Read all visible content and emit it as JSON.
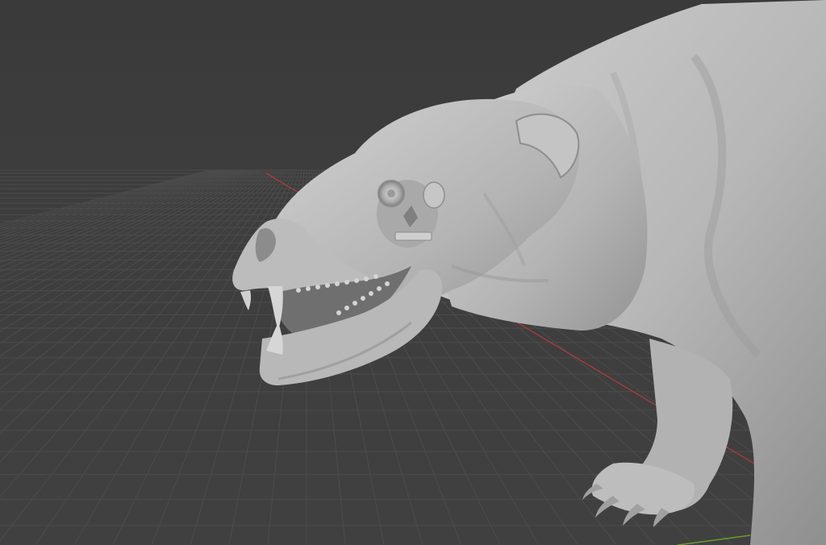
{
  "viewport": {
    "background": "#3d3d3d",
    "grid_color": "#4c4c4c",
    "x_axis_color": "#b53b3b",
    "y_axis_color": "#6a9b2e",
    "model_color": "#b9b9b9"
  },
  "model": {
    "icon": "sculpted-creature-model"
  }
}
